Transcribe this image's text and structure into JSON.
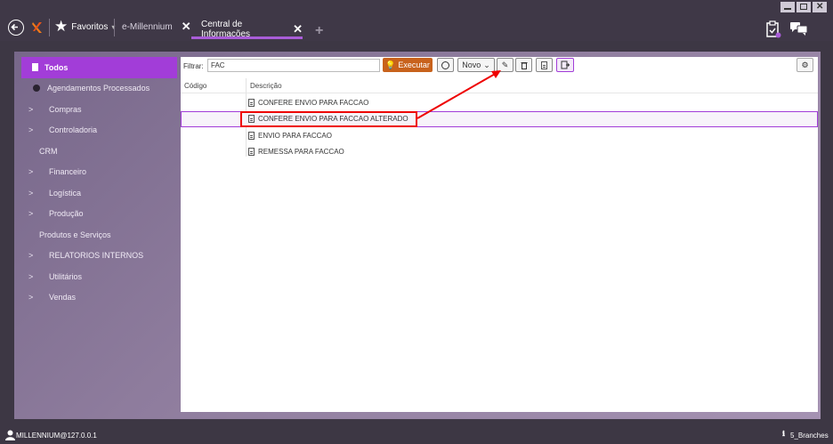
{
  "tabs": {
    "favorites_label": "Favoritos",
    "app_tab_label": "e-Millennium",
    "active_tab_label": "Central de Informações"
  },
  "sidebar": {
    "items": [
      {
        "label": "Todos",
        "active": true,
        "icon": "document-icon"
      },
      {
        "label": "Agendamentos Processados",
        "icon": "clock-icon"
      },
      {
        "label": "Compras",
        "chevron": true
      },
      {
        "label": "Controladoria",
        "chevron": true
      },
      {
        "label": "CRM"
      },
      {
        "label": "Financeiro",
        "chevron": true
      },
      {
        "label": "Logística",
        "chevron": true
      },
      {
        "label": "Produção",
        "chevron": true
      },
      {
        "label": "Produtos e Serviços"
      },
      {
        "label": "RELATORIOS INTERNOS",
        "chevron": true
      },
      {
        "label": "Utilitários",
        "chevron": true
      },
      {
        "label": "Vendas",
        "chevron": true
      }
    ]
  },
  "toolbar": {
    "filter_label": "Filtrar:",
    "filter_value": "FAC",
    "execute_label": "Executar",
    "new_label": "Novo"
  },
  "table": {
    "col_code": "Código",
    "col_desc": "Descrição",
    "rows": [
      {
        "code": "",
        "desc": "CONFERE ENVIO PARA FACCAO",
        "selected": false
      },
      {
        "code": "",
        "desc": "CONFERE ENVIO PARA FACCAO ALTERADO",
        "selected": true
      },
      {
        "code": "",
        "desc": "ENVIO PARA FACCAO",
        "selected": false
      },
      {
        "code": "",
        "desc": "REMESSA PARA FACCAO",
        "selected": false
      }
    ]
  },
  "status": {
    "connection": "MILLENNIUM@127.0.0.1",
    "branches": "5_Branches"
  },
  "colors": {
    "accent": "#a23dd8",
    "execute": "#c8621c",
    "annotation": "#ee0000"
  }
}
